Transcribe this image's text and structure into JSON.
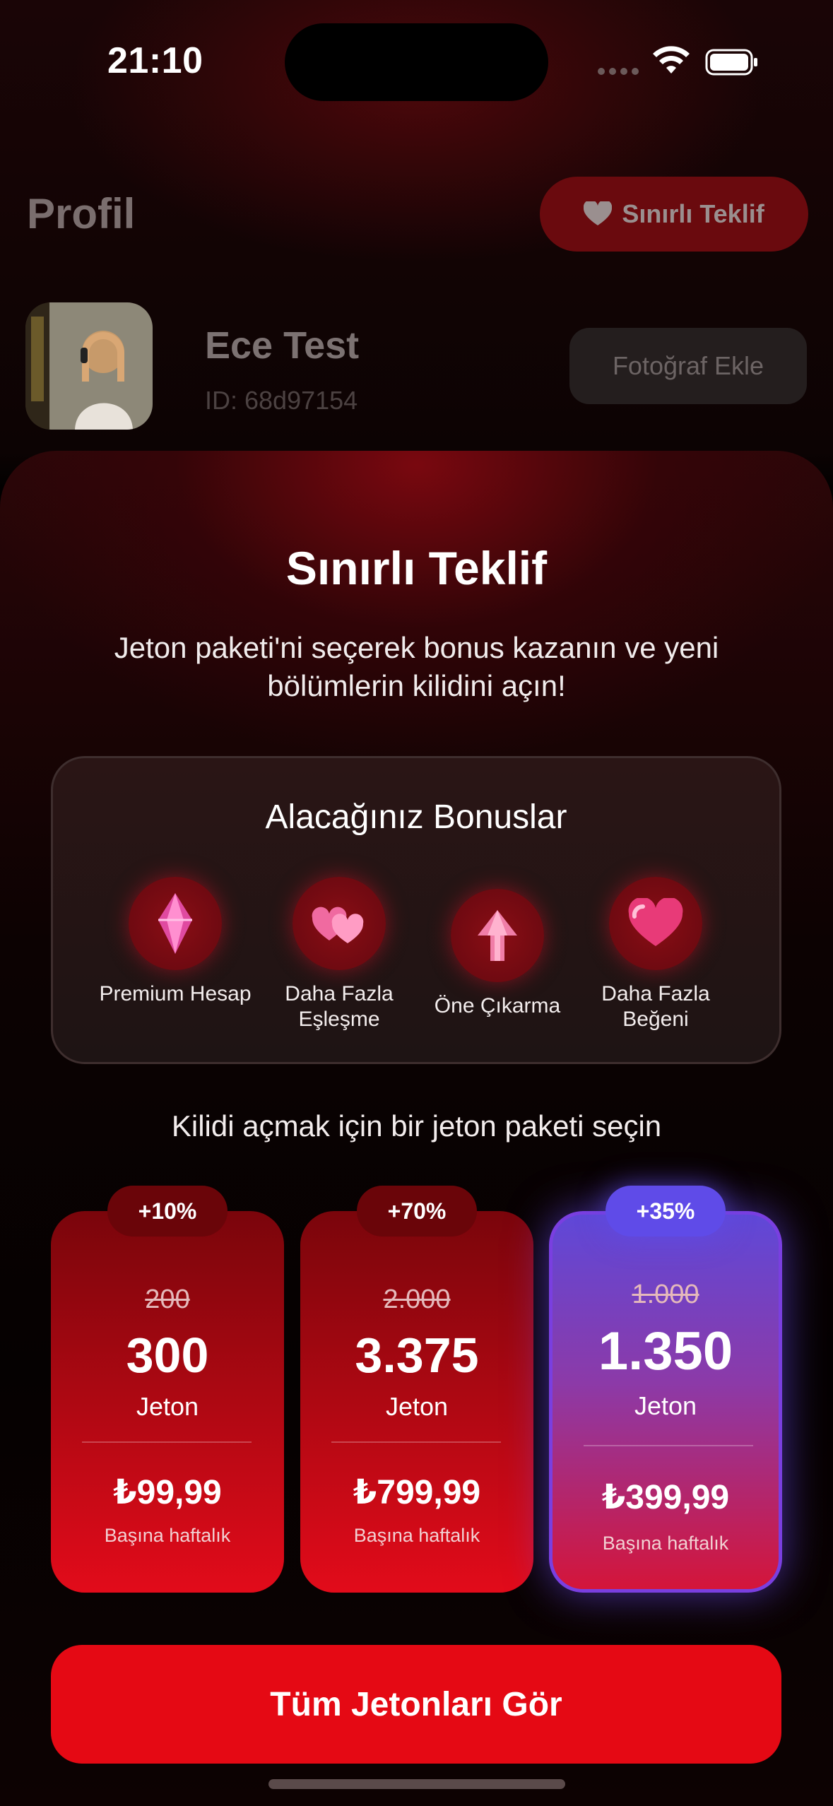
{
  "status": {
    "time": "21:10"
  },
  "profile": {
    "title": "Profil",
    "offer_pill": "Sınırlı Teklif",
    "name": "Ece Test",
    "id": "ID: 68d97154",
    "add_photo": "Fotoğraf Ekle"
  },
  "sheet": {
    "title": "Sınırlı Teklif",
    "subtitle": "Jeton paketi'ni seçerek bonus kazanın ve yeni bölümlerin kilidini açın!",
    "bonus_title": "Alacağınız Bonuslar",
    "bonuses": [
      {
        "label": "Premium Hesap",
        "icon": "diamond-icon"
      },
      {
        "label": "Daha Fazla Eşleşme",
        "icon": "hearts-icon"
      },
      {
        "label": "Öne Çıkarma",
        "icon": "arrow-up-icon"
      },
      {
        "label": "Daha Fazla Beğeni",
        "icon": "heart-icon"
      }
    ],
    "choose_text": "Kilidi açmak için bir jeton paketi seçin",
    "packages": [
      {
        "badge": "+10%",
        "old": "200",
        "amount": "300",
        "unit": "Jeton",
        "price": "₺99,99",
        "per": "Başına haftalık",
        "selected": false
      },
      {
        "badge": "+70%",
        "old": "2.000",
        "amount": "3.375",
        "unit": "Jeton",
        "price": "₺799,99",
        "per": "Başına haftalık",
        "selected": false
      },
      {
        "badge": "+35%",
        "old": "1.000",
        "amount": "1.350",
        "unit": "Jeton",
        "price": "₺399,99",
        "per": "Başına haftalık",
        "selected": true
      }
    ],
    "cta": "Tüm Jetonları Gör"
  },
  "colors": {
    "accent": "#e50914",
    "selected": "#5f4be8"
  }
}
